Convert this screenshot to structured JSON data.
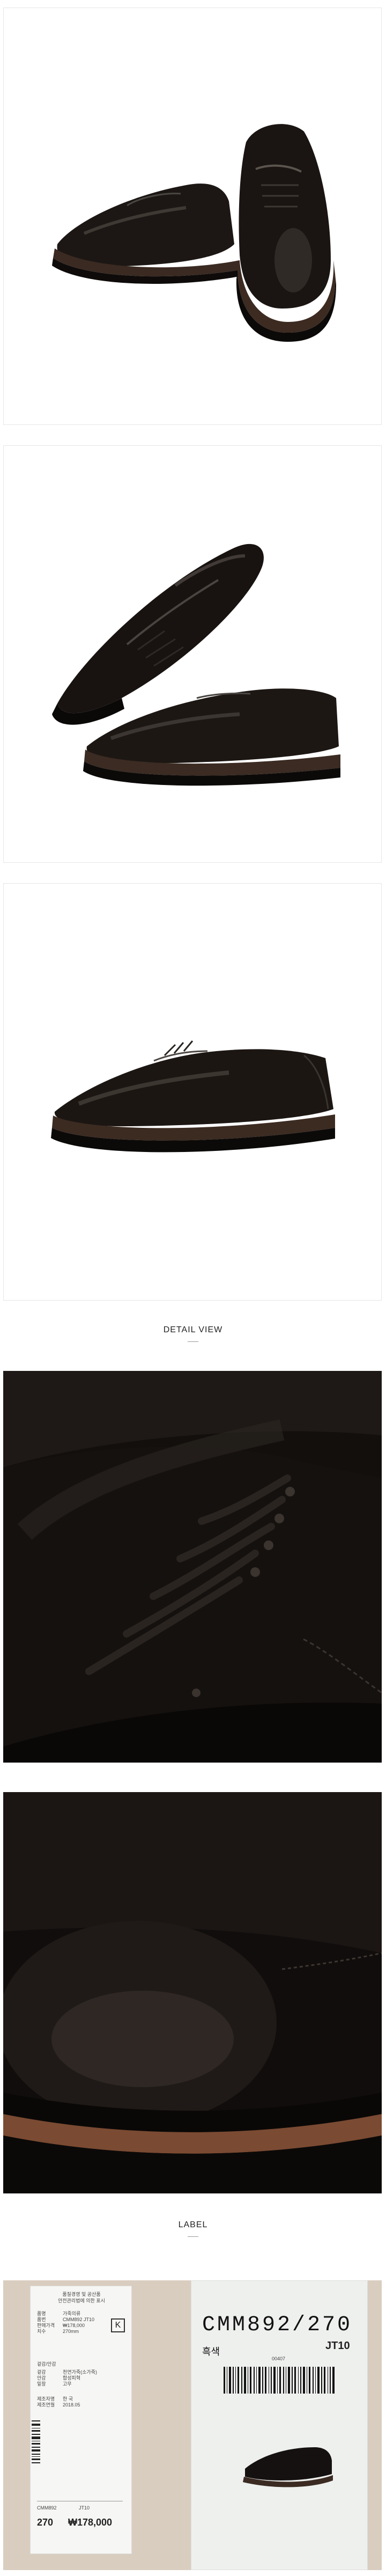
{
  "sections": {
    "detail_view": "DETAIL VIEW",
    "label": "LABEL"
  },
  "label_left": {
    "header_line1": "품질경영 및 공산품",
    "header_line2": "안전관리법에 의한 표시",
    "rows": [
      {
        "k": "품명",
        "v": "가죽의류"
      },
      {
        "k": "품번",
        "v": "CMM892 JT10"
      },
      {
        "k": "판매가격",
        "v": "₩178,000"
      },
      {
        "k": "치수",
        "v": "270mm"
      }
    ],
    "material_title": "겉감/안감",
    "material_rows": [
      {
        "k": "겉감",
        "v": "천연가죽(소가죽)"
      },
      {
        "k": "안감",
        "v": "합성피혁"
      },
      {
        "k": "밑창",
        "v": "고무"
      }
    ],
    "maker_rows": [
      {
        "k": "제조자명",
        "v": "한 국"
      },
      {
        "k": "제조연월",
        "v": "2018.05"
      }
    ],
    "footer": "CMM892",
    "footer_sub": "JT10",
    "size": "270",
    "price": "₩178,000"
  },
  "label_right": {
    "code": "CMM892/270",
    "color": "흑색",
    "small_no": "00407",
    "jt": "JT10"
  }
}
